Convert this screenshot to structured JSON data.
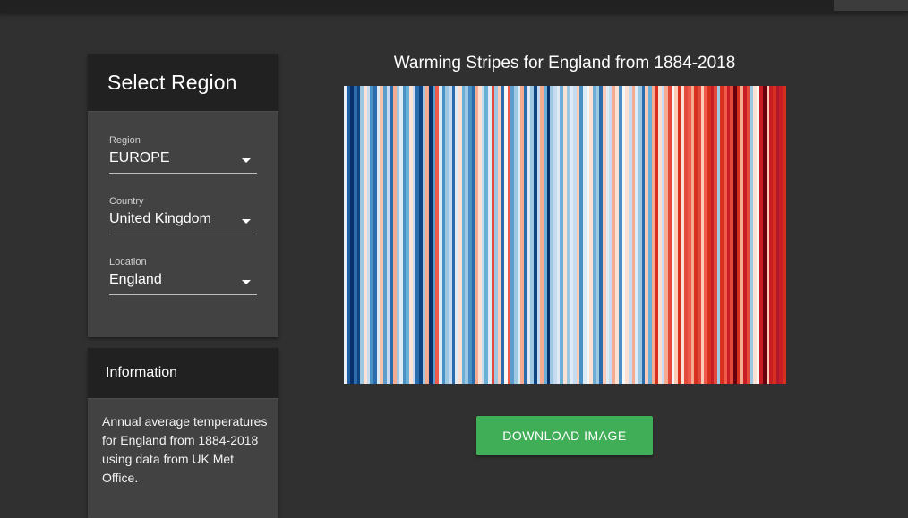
{
  "region_card": {
    "title": "Select Region",
    "fields": [
      {
        "label": "Region",
        "value": "EUROPE"
      },
      {
        "label": "Country",
        "value": "United Kingdom"
      },
      {
        "label": "Location",
        "value": "England"
      }
    ]
  },
  "info_card": {
    "title": "Information",
    "text": "Annual average temperatures for England from 1884-2018 using data from UK Met Office."
  },
  "download": {
    "label": "DOWNLOAD IMAGE"
  },
  "colors": {
    "background": "#303030",
    "card": "#424242",
    "card_header": "#212121",
    "button": "#3fae57"
  },
  "chart_data": {
    "type": "heatmap",
    "title": "Warming Stripes for England from 1884-2018",
    "xlabel": "",
    "ylabel": "",
    "years": [
      1884,
      2018
    ],
    "stripe_colors": [
      "#e9f1f8",
      "#1f5fa3",
      "#08306b",
      "#2b6cad",
      "#0e4482",
      "#9ec8e1",
      "#fbe0d4",
      "#c6dbef",
      "#4a91c6",
      "#2b6cad",
      "#deebf7",
      "#f6c2a9",
      "#5d9dcd",
      "#c6dbef",
      "#2b6cad",
      "#f4ab8f",
      "#9ec8e1",
      "#deebf7",
      "#4a91c6",
      "#6baed6",
      "#fbe0d4",
      "#c6dbef",
      "#2b6cad",
      "#0e4482",
      "#9ec8e1",
      "#f4ab8f",
      "#08306b",
      "#5d9dcd",
      "#ef5a4a",
      "#deebf7",
      "#4a91c6",
      "#9ec8e1",
      "#c6dbef",
      "#2b6cad",
      "#deebf7",
      "#fbe0d4",
      "#6baed6",
      "#9ec8e1",
      "#4a91c6",
      "#2b6cad",
      "#f4ab8f",
      "#fbe0d4",
      "#c6dbef",
      "#6baed6",
      "#deebf7",
      "#e34a3b",
      "#9ec8e1",
      "#fcccb8",
      "#2b6cad",
      "#f7f7f7",
      "#ef5a4a",
      "#5d9dcd",
      "#9ec8e1",
      "#deebf7",
      "#f4ab8f",
      "#2b6cad",
      "#deebf7",
      "#9ec8e1",
      "#0e4482",
      "#c6dbef",
      "#f4ab8f",
      "#6baed6",
      "#08306b",
      "#9ec8e1",
      "#c6dbef",
      "#deebf7",
      "#6baed6",
      "#fbe0d4",
      "#9ec8e1",
      "#deebf7",
      "#c6dbef",
      "#fcccb8",
      "#4a91c6",
      "#deebf7",
      "#f7f7f7",
      "#fbe0d4",
      "#6baed6",
      "#9ec8e1",
      "#2b6cad",
      "#fcccb8",
      "#deebf7",
      "#c6dbef",
      "#f4ab8f",
      "#fbe0d4",
      "#4a91c6",
      "#f7f7f7",
      "#fbe0d4",
      "#c6dbef",
      "#f4ab8f",
      "#deebf7",
      "#9ec8e1",
      "#2b6cad",
      "#fcccb8",
      "#6baed6",
      "#f4ab8f",
      "#d7301f",
      "#fbe0d4",
      "#c6dbef",
      "#f4ab8f",
      "#e34a3b",
      "#f7f7f7",
      "#fcccb8",
      "#d7301f",
      "#fbe0d4",
      "#e34a3b",
      "#ef5a4a",
      "#f4ab8f",
      "#d7301f",
      "#e34a3b",
      "#fcccb8",
      "#ef5a4a",
      "#d7301f",
      "#c81d25",
      "#e34a3b",
      "#9ec8e1",
      "#d7301f",
      "#ef5a4a",
      "#c81d25",
      "#e34a3b",
      "#67000d",
      "#d7301f",
      "#f4ab8f",
      "#c81d25",
      "#e34a3b",
      "#9ec8e1",
      "#fbe0d4",
      "#f7f7f7",
      "#c81d25",
      "#67000d",
      "#fcccb8",
      "#c81d25",
      "#d7301f",
      "#b2182b",
      "#c81d25",
      "#d7301f"
    ]
  }
}
